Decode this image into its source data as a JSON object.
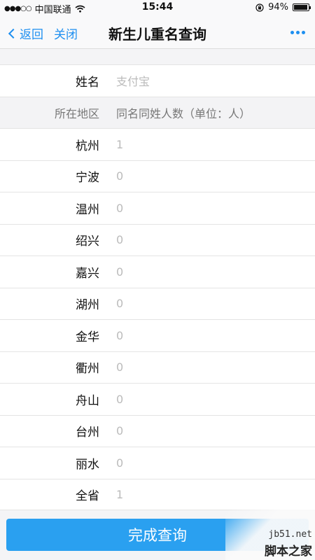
{
  "status_bar": {
    "signal_dots": "●●●○○",
    "carrier": "中国联通",
    "time": "15:44",
    "battery": "94%",
    "battery_level": 0.94,
    "icons": [
      "wifi-icon",
      "lock-rotation-icon",
      "battery-icon"
    ]
  },
  "nav": {
    "back_label": "返回",
    "close_label": "关闭",
    "title": "新生儿重名查询",
    "more_icon": "more-dots-icon",
    "accent": "#1d8ff0"
  },
  "form": {
    "name_label": "姓名",
    "name_placeholder": "支付宝",
    "header_label": "所在地区",
    "header_value": "同名同姓人数（单位：人）",
    "regions": [
      {
        "name": "杭州",
        "count": "1"
      },
      {
        "name": "宁波",
        "count": "0"
      },
      {
        "name": "温州",
        "count": "0"
      },
      {
        "name": "绍兴",
        "count": "0"
      },
      {
        "name": "嘉兴",
        "count": "0"
      },
      {
        "name": "湖州",
        "count": "0"
      },
      {
        "name": "金华",
        "count": "0"
      },
      {
        "name": "衢州",
        "count": "0"
      },
      {
        "name": "舟山",
        "count": "0"
      },
      {
        "name": "台州",
        "count": "0"
      },
      {
        "name": "丽水",
        "count": "0"
      },
      {
        "name": "全省",
        "count": "1"
      }
    ]
  },
  "submit": {
    "label": "完成查询",
    "color": "#2aa0f0"
  },
  "watermark": {
    "url": "jb51.net",
    "brand": "脚本之家"
  }
}
